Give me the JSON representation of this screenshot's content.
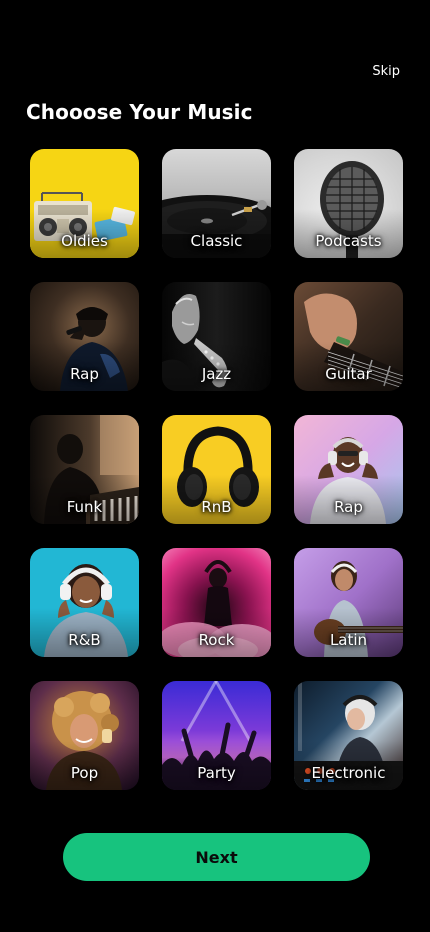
{
  "header": {
    "skip_label": "Skip",
    "title": "Chooose Your Music"
  },
  "genres": [
    {
      "label": "Oldies",
      "art": "boombox-on-yellow"
    },
    {
      "label": "Classic",
      "art": "vinyl-turntable"
    },
    {
      "label": "Podcasts",
      "art": "studio-microphone"
    },
    {
      "label": "Rap",
      "art": "rapper-with-mic"
    },
    {
      "label": "Jazz",
      "art": "saxophone-player"
    },
    {
      "label": "Guitar",
      "art": "hand-on-guitar"
    },
    {
      "label": "Funk",
      "art": "piano-player-silhouette"
    },
    {
      "label": "RnB",
      "art": "headphones-on-yellow"
    },
    {
      "label": "Rap",
      "art": "man-with-headphones"
    },
    {
      "label": "R&B",
      "art": "girl-with-headphones"
    },
    {
      "label": "Rock",
      "art": "pink-smoke-performer"
    },
    {
      "label": "Latin",
      "art": "woman-playing-guitar"
    },
    {
      "label": "Pop",
      "art": "curly-hair-woman-headphones"
    },
    {
      "label": "Party",
      "art": "concert-crowd"
    },
    {
      "label": "Electronic",
      "art": "dj-at-mixer"
    }
  ],
  "footer": {
    "next_label": "Next"
  },
  "colors": {
    "background": "#000000",
    "accent": "#17c37e",
    "text": "#ffffff"
  }
}
